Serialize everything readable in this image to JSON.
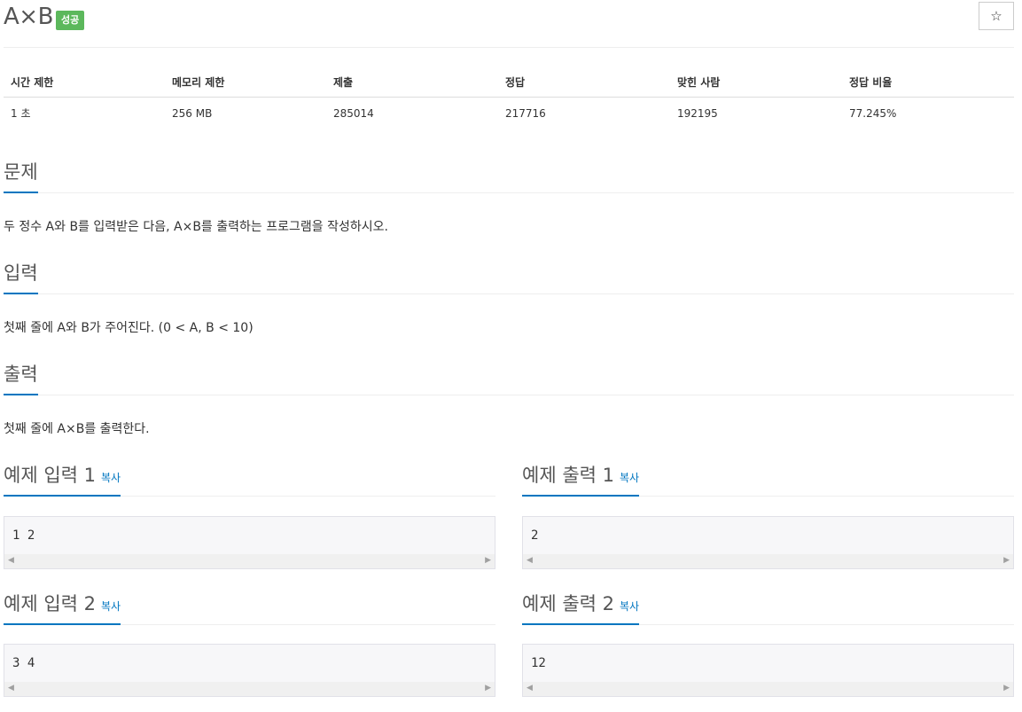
{
  "problem": {
    "title": "A×B",
    "status_badge": "성공",
    "star_icon": "☆"
  },
  "info": {
    "headers": [
      "시간 제한",
      "메모리 제한",
      "제출",
      "정답",
      "맞힌 사람",
      "정답 비율"
    ],
    "values": [
      "1 초",
      "256 MB",
      "285014",
      "217716",
      "192195",
      "77.245%"
    ]
  },
  "sections": {
    "description": {
      "heading": "문제",
      "text": "두 정수 A와 B를 입력받은 다음, A×B를 출력하는 프로그램을 작성하시오."
    },
    "input": {
      "heading": "입력",
      "text": "첫째 줄에 A와 B가 주어진다. (0 < A, B < 10)"
    },
    "output": {
      "heading": "출력",
      "text": "첫째 줄에 A×B를 출력한다."
    }
  },
  "samples": [
    {
      "input_heading": "예제 입력 1",
      "input_copy": "복사",
      "input": "1 2",
      "output_heading": "예제 출력 1",
      "output_copy": "복사",
      "output": "2"
    },
    {
      "input_heading": "예제 입력 2",
      "input_copy": "복사",
      "input": "3 4",
      "output_heading": "예제 출력 2",
      "output_copy": "복사",
      "output": "12"
    }
  ],
  "scroll": {
    "left_arrow": "◀",
    "right_arrow": "▶"
  },
  "colors": {
    "accent": "#0076c0",
    "success": "#5cb85c"
  }
}
